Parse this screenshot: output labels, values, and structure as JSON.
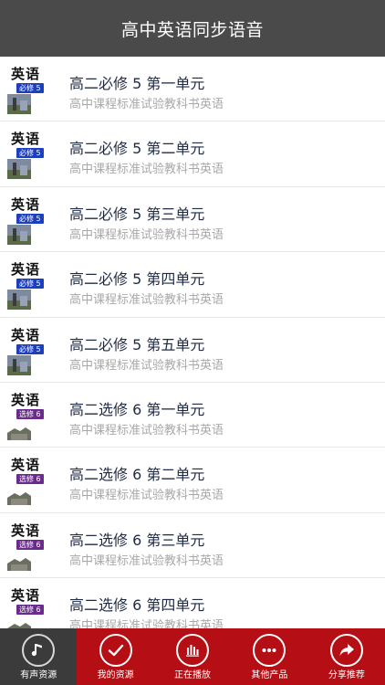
{
  "header": {
    "title": "高中英语同步语音"
  },
  "colors": {
    "header_bg": "#4a4a4b",
    "tabbar_bg": "#b50e14",
    "active_tab_bg": "#3b3b3b",
    "tag_blue": "#1c3fbf",
    "tag_purple": "#6a2b8c"
  },
  "list": {
    "items": [
      {
        "cover_text": "英语",
        "cover_tag": "必修 5",
        "title": "高二必修 5 第一单元",
        "subtitle": "高中课程标准试验教科书英语"
      },
      {
        "cover_text": "英语",
        "cover_tag": "必修 5",
        "title": "高二必修 5 第二单元",
        "subtitle": "高中课程标准试验教科书英语"
      },
      {
        "cover_text": "英语",
        "cover_tag": "必修 5",
        "title": "高二必修 5 第三单元",
        "subtitle": "高中课程标准试验教科书英语"
      },
      {
        "cover_text": "英语",
        "cover_tag": "必修 5",
        "title": "高二必修 5 第四单元",
        "subtitle": "高中课程标准试验教科书英语"
      },
      {
        "cover_text": "英语",
        "cover_tag": "必修 5",
        "title": "高二必修 5 第五单元",
        "subtitle": "高中课程标准试验教科书英语"
      },
      {
        "cover_text": "英语",
        "cover_tag": "选修 6",
        "title": "高二选修 6 第一单元",
        "subtitle": "高中课程标准试验教科书英语"
      },
      {
        "cover_text": "英语",
        "cover_tag": "选修 6",
        "title": "高二选修 6 第二单元",
        "subtitle": "高中课程标准试验教科书英语"
      },
      {
        "cover_text": "英语",
        "cover_tag": "选修 6",
        "title": "高二选修 6 第三单元",
        "subtitle": "高中课程标准试验教科书英语"
      },
      {
        "cover_text": "英语",
        "cover_tag": "选修 6",
        "title": "高二选修 6 第四单元",
        "subtitle": "高中课程标准试验教科书英语"
      }
    ]
  },
  "tabbar": {
    "tabs": [
      {
        "label": "有声资源",
        "icon": "music-note-icon",
        "active": true
      },
      {
        "label": "我的资源",
        "icon": "checkmark-icon",
        "active": false
      },
      {
        "label": "正在播放",
        "icon": "equalizer-icon",
        "active": false
      },
      {
        "label": "其他产品",
        "icon": "more-dots-icon",
        "active": false
      },
      {
        "label": "分享推荐",
        "icon": "share-arrow-icon",
        "active": false
      }
    ]
  }
}
